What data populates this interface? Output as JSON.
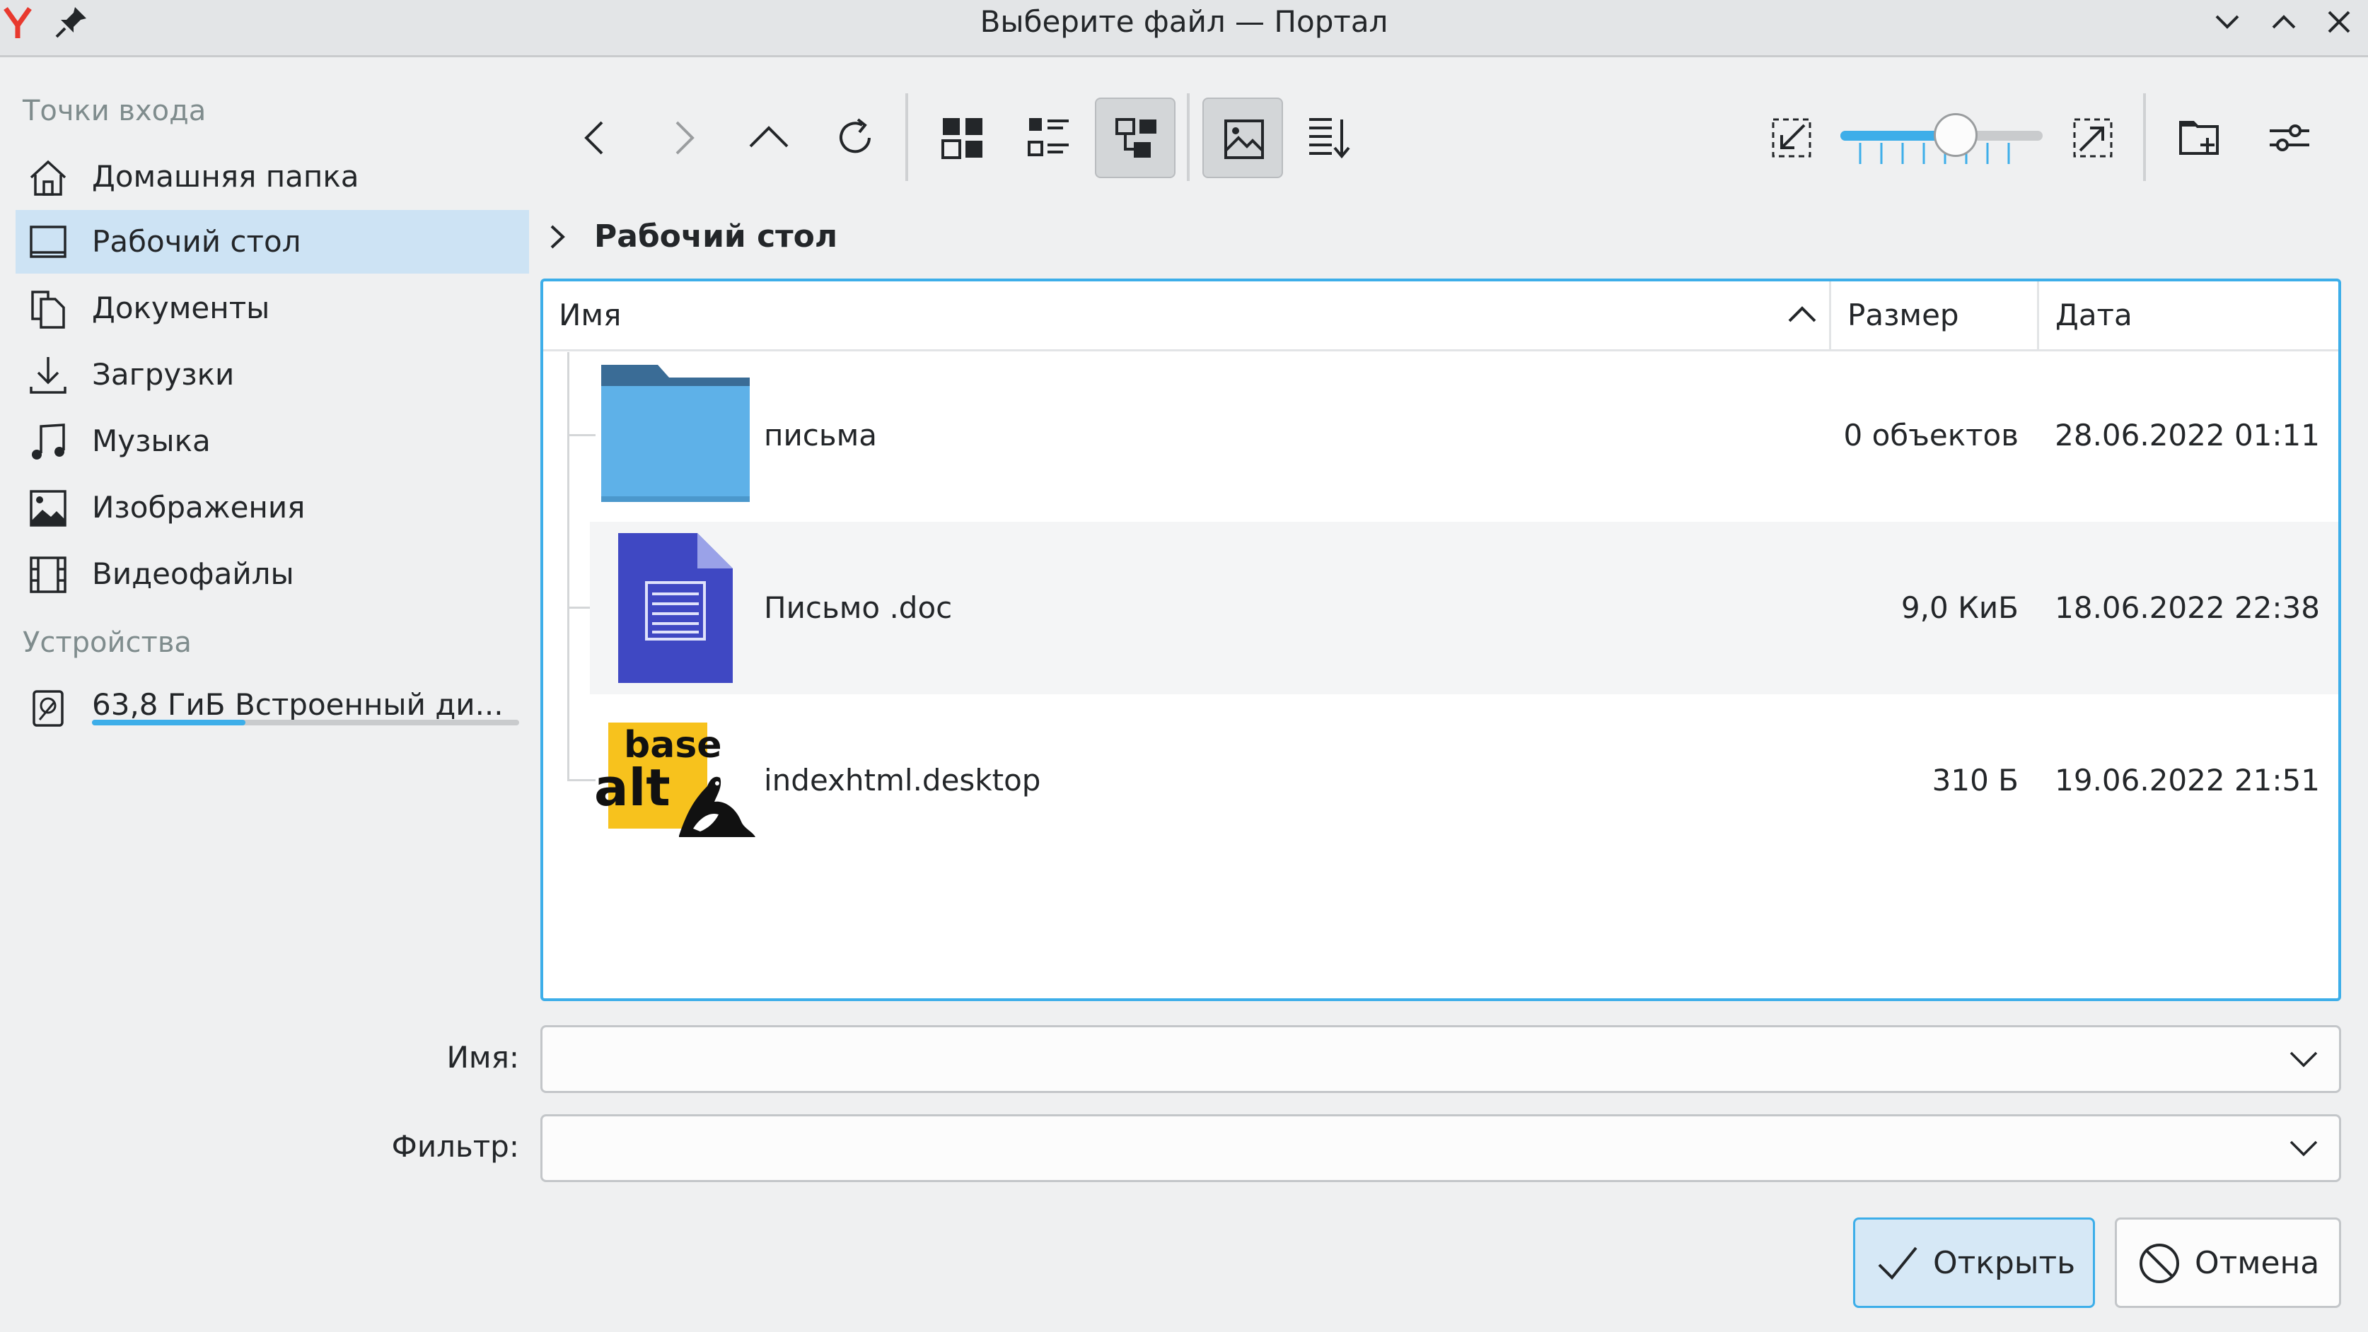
{
  "window": {
    "title": "Выберите файл — Портал"
  },
  "sidebar": {
    "places_header": "Точки входа",
    "places": [
      {
        "label": "Домашняя папка",
        "icon": "home-icon"
      },
      {
        "label": "Рабочий стол",
        "icon": "desktop-icon",
        "selected": true
      },
      {
        "label": "Документы",
        "icon": "documents-icon"
      },
      {
        "label": "Загрузки",
        "icon": "downloads-icon"
      },
      {
        "label": "Музыка",
        "icon": "music-icon"
      },
      {
        "label": "Изображения",
        "icon": "pictures-icon"
      },
      {
        "label": "Видеофайлы",
        "icon": "videos-icon"
      }
    ],
    "devices_header": "Устройства",
    "devices": [
      {
        "label": "63,8 ГиБ Встроенный ди...",
        "icon": "drive-icon",
        "usage_fraction": 0.36
      }
    ]
  },
  "toolbar": {
    "zoom_level_fraction": 0.57,
    "active_view": "detail-tree-view",
    "preview_enabled": true
  },
  "breadcrumb": {
    "current": "Рабочий стол"
  },
  "columns": {
    "name": "Имя",
    "size": "Размер",
    "date": "Дата"
  },
  "files": [
    {
      "name": "письма",
      "size": "0 объектов",
      "date": "28.06.2022 01:11",
      "icon": "folder-icon"
    },
    {
      "name": "Письмо .doc",
      "size": "9,0 КиБ",
      "date": "18.06.2022 22:38",
      "icon": "document-icon"
    },
    {
      "name": "indexhtml.desktop",
      "size": "310 Б",
      "date": "19.06.2022 21:51",
      "icon": "basealt-logo-icon",
      "logo_text": [
        "base",
        "alt"
      ]
    }
  ],
  "form": {
    "name_label": "Имя:",
    "name_value": "",
    "filter_label": "Фильтр:",
    "filter_value": ""
  },
  "buttons": {
    "open": "Открыть",
    "cancel": "Отмена"
  },
  "colors": {
    "accent": "#3daee9",
    "selection": "#cde3f4",
    "folder": "#5eb1e8",
    "document": "#3f48c3"
  }
}
